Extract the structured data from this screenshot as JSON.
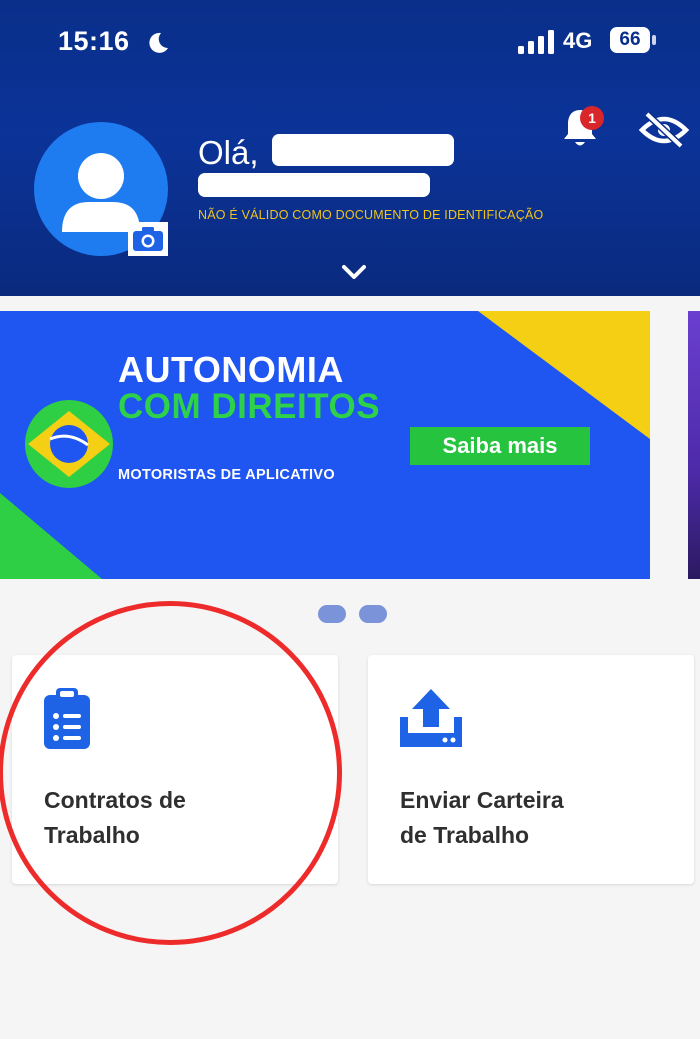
{
  "status_bar": {
    "time": "15:16",
    "network": "4G",
    "battery": "66"
  },
  "header": {
    "greeting": "Olá,",
    "disclaimer": "NÃO É VÁLIDO COMO DOCUMENTO DE IDENTIFICAÇÃO",
    "notification_count": "1",
    "icons": [
      "moon-icon",
      "signal-icon",
      "camera-icon",
      "bell-icon",
      "eye-off-icon",
      "chevron-down-icon"
    ]
  },
  "banner": {
    "title_line1": "AUTONOMIA",
    "title_line2": "COM DIREITOS",
    "subtitle": "MOTORISTAS DE APLICATIVO",
    "button_label": "Saiba mais"
  },
  "cards": [
    {
      "label_line1": "Contratos de",
      "label_line2": "Trabalho",
      "icon": "clipboard-list-icon"
    },
    {
      "label_line1": "Enviar Carteira",
      "label_line2": "de Trabalho",
      "icon": "upload-icon"
    }
  ],
  "colors": {
    "header_blue": "#0a2f8a",
    "banner_blue": "#1f55f0",
    "accent_green": "#25c33e",
    "accent_yellow": "#f0c419",
    "icon_blue": "#1e63e6",
    "highlight_red": "#ee2b2b"
  }
}
